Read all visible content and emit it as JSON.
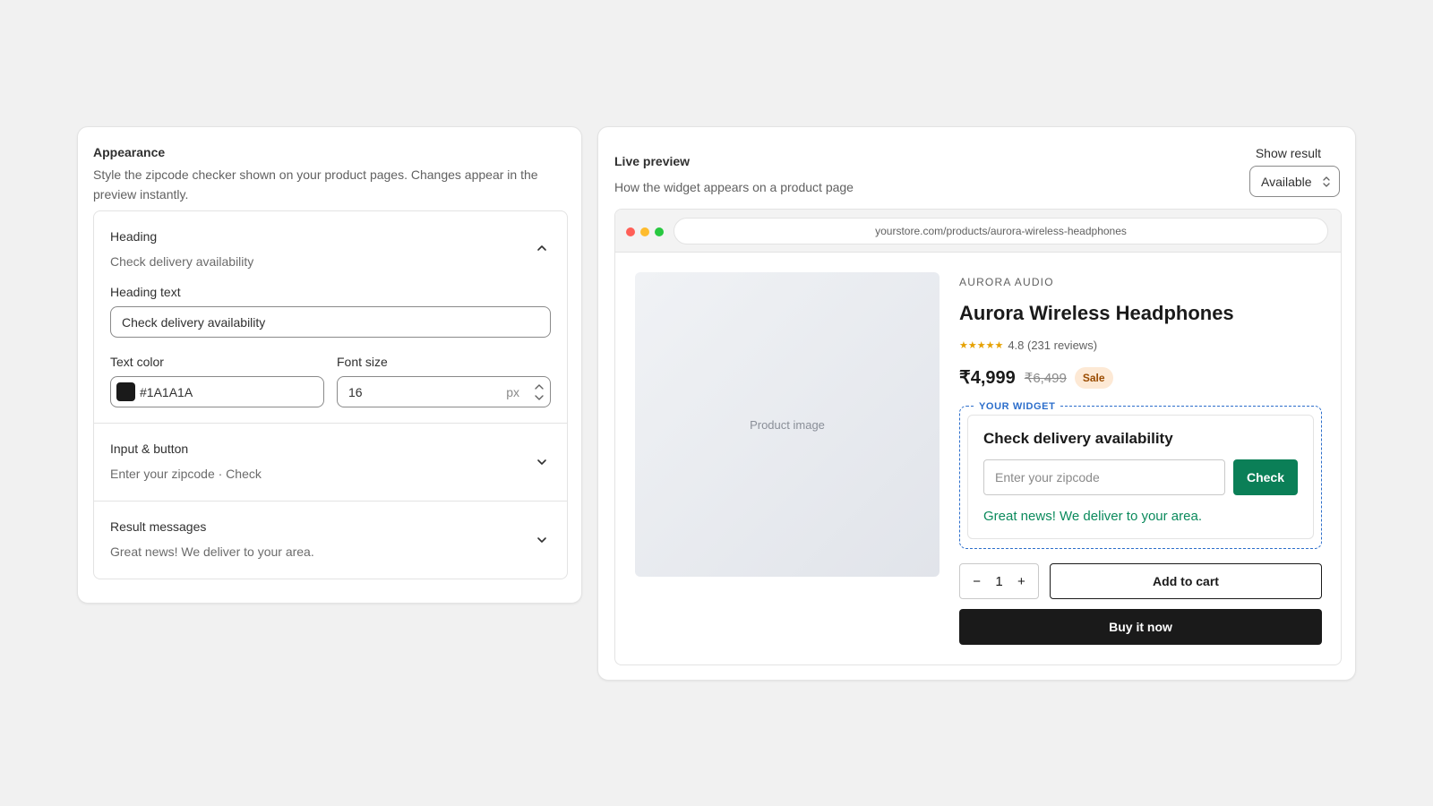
{
  "appearance": {
    "title": "Appearance",
    "description": "Style the zipcode checker shown on your product pages. Changes appear in the preview instantly.",
    "sections": [
      {
        "title": "Heading",
        "summary": "Check delivery availability",
        "expanded": true,
        "fields": {
          "heading_text_label": "Heading text",
          "heading_text_value": "Check delivery availability",
          "text_color_label": "Text color",
          "text_color_value": "#1A1A1A",
          "font_size_label": "Font size",
          "font_size_value": "16",
          "font_size_unit": "px"
        }
      },
      {
        "title": "Input & button",
        "summary": "Enter your zipcode · Check",
        "expanded": false
      },
      {
        "title": "Result messages",
        "summary": "Great news! We deliver to your area.",
        "expanded": false
      }
    ]
  },
  "preview": {
    "title": "Live preview",
    "subtitle": "How the widget appears on a product page",
    "show_result_label": "Show result",
    "show_result_value": "Available",
    "browser": {
      "url": "yourstore.com/products/aurora-wireless-headphones",
      "dot_colors": [
        "#ff5f57",
        "#febc2e",
        "#28c840"
      ]
    },
    "product": {
      "image_placeholder": "Product image",
      "vendor": "AURORA AUDIO",
      "title": "Aurora Wireless Headphones",
      "stars": "★★★★★",
      "rating": "4.8 (231 reviews)",
      "price": "₹4,999",
      "compare_price": "₹6,499",
      "sale_badge": "Sale",
      "quantity": "1",
      "qty_minus": "−",
      "qty_plus": "+",
      "add_to_cart": "Add to cart",
      "buy_now": "Buy it now"
    },
    "widget": {
      "tag": "YOUR WIDGET",
      "heading": "Check delivery availability",
      "input_placeholder": "Enter your zipcode",
      "button_label": "Check",
      "result_message": "Great news! We deliver to your area."
    }
  },
  "colors": {
    "widget_button": "#0b7f57",
    "widget_success": "#0b8a5c",
    "widget_outline": "#2c6ecb",
    "heading_text": "#1A1A1A"
  }
}
